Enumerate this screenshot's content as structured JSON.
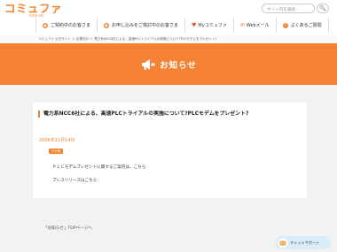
{
  "header": {
    "logo_text": "コミュファ",
    "logo_sub": "from ctc",
    "search": {
      "placeholder": "サイト内を検索",
      "button": "🔍"
    }
  },
  "nav": [
    {
      "icon": "person-icon",
      "label": "ご契約中のお客さま"
    },
    {
      "icon": "person-icon",
      "label": "お申し込みをご検討中のお客さま"
    },
    {
      "icon": "heart-icon",
      "label": "Myコミュファ"
    },
    {
      "icon": "mail-icon",
      "label": "Webメール"
    },
    {
      "icon": "question-icon",
      "label": "よくあるご質問"
    }
  ],
  "breadcrumb": "コミュファ 公式サイト ＞ 企業向け ＞ 電力系NCC6社による、高速PLCトライアルの実施について?PLCモデムをプレゼント?",
  "banner": {
    "title": "お知らせ"
  },
  "article": {
    "title": "電力系NCC6社による、高速PLCトライアルの実施について?PLCモデムをプレゼント?",
    "date": "2006年11月14日",
    "badge": "その他",
    "link1": "ＰＬＣモデムプレゼントに関するご案内は、こちら",
    "link2": "プレスリリースはこちら"
  },
  "footer": {
    "backlink": "「お知らせ」TOPページへ"
  },
  "chat": {
    "label": "チャットサポート"
  },
  "colors": {
    "accent": "#f58234",
    "page_bg": "#f2f2f2"
  }
}
